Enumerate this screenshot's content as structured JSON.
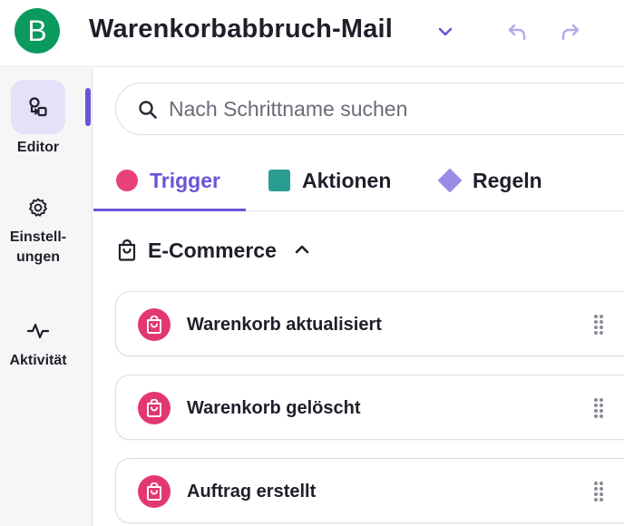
{
  "header": {
    "logo_letter": "B",
    "title": "Warenkorbabbruch-Mail",
    "icons": [
      "chevron-down-icon",
      "undo-icon",
      "redo-icon"
    ]
  },
  "sidebar": {
    "items": [
      {
        "label": "Editor",
        "icon": "workflow-icon",
        "active": true
      },
      {
        "label": "Einstell-\nungen",
        "icon": "gear-icon",
        "active": false
      },
      {
        "label": "Aktivität",
        "icon": "activity-icon",
        "active": false
      }
    ]
  },
  "search": {
    "placeholder": "Nach Schrittname suchen",
    "value": ""
  },
  "tabs": [
    {
      "label": "Trigger",
      "color": "#e8417a",
      "shape": "circle",
      "active": true
    },
    {
      "label": "Aktionen",
      "color": "#2a9d92",
      "shape": "square",
      "active": false
    },
    {
      "label": "Regeln",
      "color": "#9b8ae6",
      "shape": "diamond",
      "active": false
    }
  ],
  "section": {
    "title": "E-Commerce",
    "icon": "shopping-bag-icon",
    "expanded": true
  },
  "steps": [
    {
      "label": "Warenkorb aktualisiert",
      "icon": "shopping-bag-icon"
    },
    {
      "label": "Warenkorb gelöscht",
      "icon": "shopping-bag-icon"
    },
    {
      "label": "Auftrag erstellt",
      "icon": "shopping-bag-icon"
    }
  ],
  "colors": {
    "accent": "#6a55d8",
    "brand": "#0b9a5e",
    "trigger_icon": "#e3386f"
  }
}
